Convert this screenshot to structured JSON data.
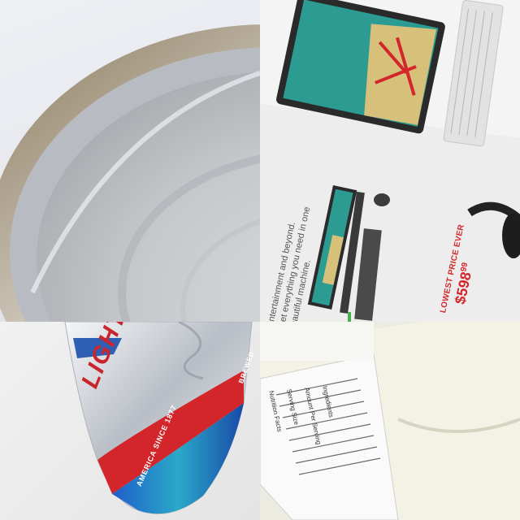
{
  "catalog": {
    "blurb": [
      "entertainment and beyond.",
      "Get everything you need in one",
      "beautiful machine."
    ],
    "promo_headline": "LOWEST PRICE EVER",
    "promo_price": "$598",
    "promo_cents": "99"
  },
  "can": {
    "brand": "LIGHT",
    "band_text": "AMERICA SINCE 1877",
    "side_text": "BREWED"
  },
  "jug": {
    "label_lines": [
      "Nutrition Facts",
      "Serving Size",
      "Amount Per Serving",
      "Ingredients"
    ]
  },
  "colors": {
    "accent_red": "#d3262b",
    "can_blue": "#1f5ec9",
    "can_teal": "#2aa9c9",
    "tablet_teal": "#2c9c93"
  }
}
